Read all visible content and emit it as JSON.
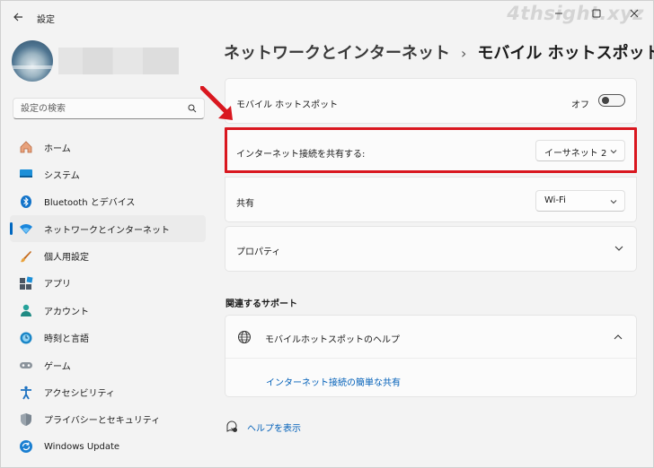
{
  "window": {
    "title": "設定",
    "controls": [
      "minimize",
      "maximize",
      "close"
    ]
  },
  "watermark": "4thsight.xyz",
  "search": {
    "placeholder": "設定の検索"
  },
  "sidebar": {
    "items": [
      {
        "label": "ホーム",
        "icon": "home-icon",
        "active": false
      },
      {
        "label": "システム",
        "icon": "system-icon",
        "active": false
      },
      {
        "label": "Bluetooth とデバイス",
        "icon": "bluetooth-icon",
        "active": false
      },
      {
        "label": "ネットワークとインターネット",
        "icon": "network-icon",
        "active": true
      },
      {
        "label": "個人用設定",
        "icon": "brush-icon",
        "active": false
      },
      {
        "label": "アプリ",
        "icon": "apps-icon",
        "active": false
      },
      {
        "label": "アカウント",
        "icon": "account-icon",
        "active": false
      },
      {
        "label": "時刻と言語",
        "icon": "time-language-icon",
        "active": false
      },
      {
        "label": "ゲーム",
        "icon": "gamepad-icon",
        "active": false
      },
      {
        "label": "アクセシビリティ",
        "icon": "accessibility-icon",
        "active": false
      },
      {
        "label": "プライバシーとセキュリティ",
        "icon": "shield-icon",
        "active": false
      },
      {
        "label": "Windows Update",
        "icon": "windows-update-icon",
        "active": false
      }
    ]
  },
  "breadcrumb": {
    "parent": "ネットワークとインターネット",
    "separator": "›",
    "current": "モバイル ホットスポット"
  },
  "hotspot": {
    "label": "モバイル ホットスポット",
    "state_text": "オフ",
    "enabled": false
  },
  "share_from": {
    "label": "インターネット接続を共有する:",
    "selected": "イーサネット 2"
  },
  "share_over": {
    "label": "共有",
    "selected": "Wi-Fi"
  },
  "properties": {
    "label": "プロパティ"
  },
  "related": {
    "title": "関連するサポート",
    "help_title": "モバイルホットスポットのヘルプ",
    "help_link": "インターネット接続の簡単な共有"
  },
  "show_help": {
    "label": "ヘルプを表示"
  },
  "colors": {
    "accent": "#0067c0",
    "highlight": "#d9171f",
    "link": "#005fb8"
  }
}
